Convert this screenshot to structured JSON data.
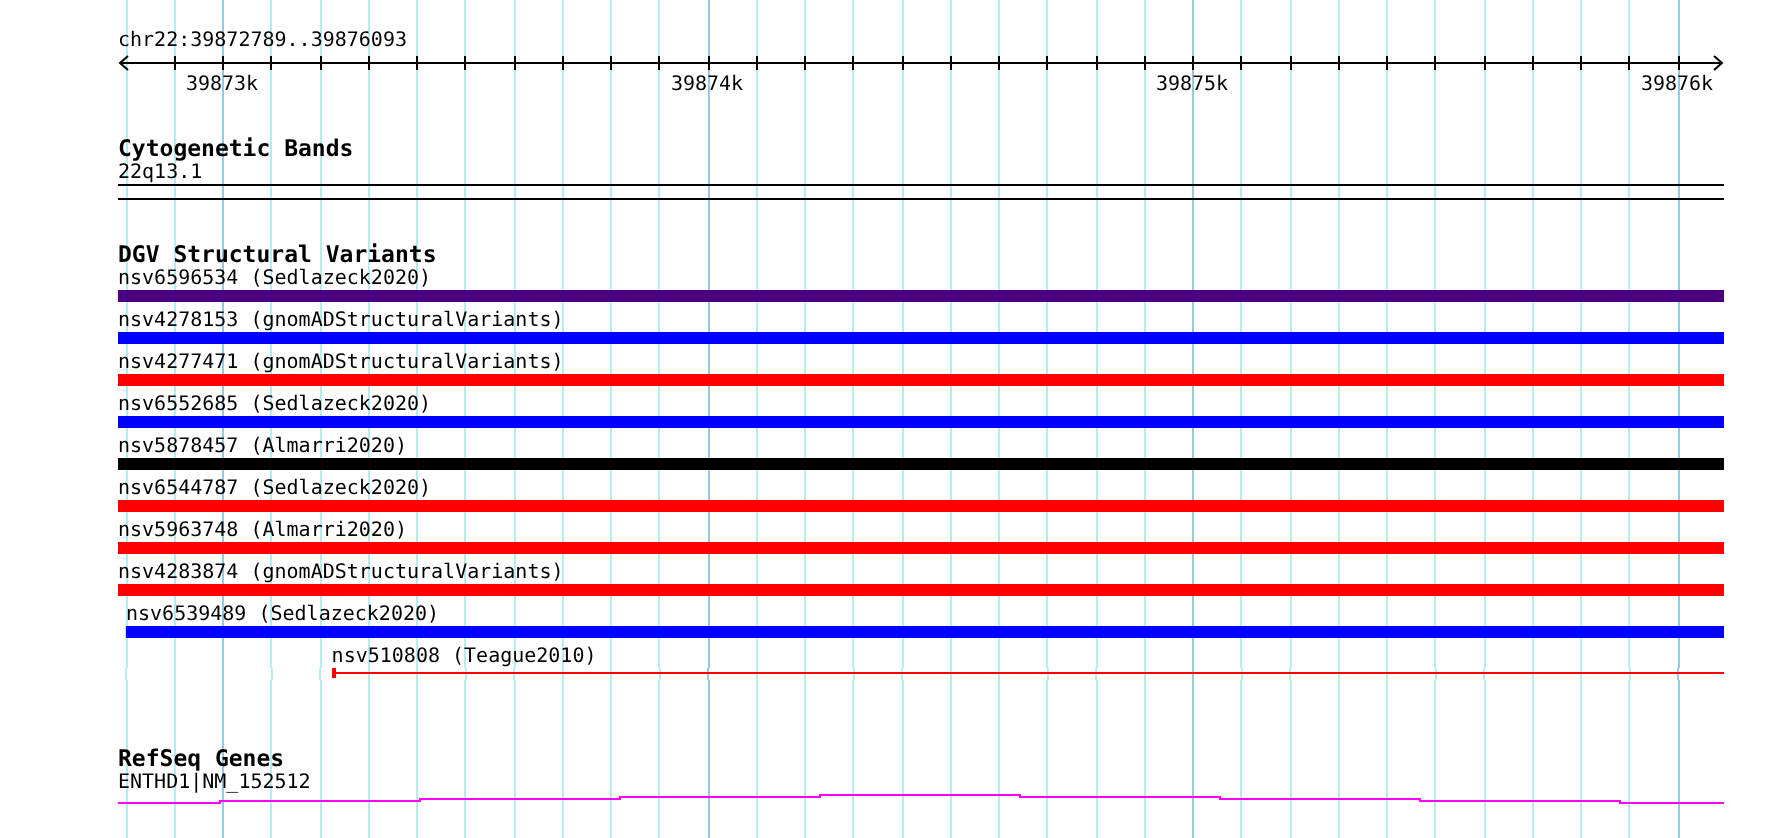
{
  "ruler": {
    "location": "chr22:39872789..39876093",
    "ticks": [
      "39873k",
      "39874k",
      "39875k",
      "39876k"
    ]
  },
  "tracks": [
    {
      "title": "Cytogenetic Bands",
      "kind": "cytoband",
      "features": [
        {
          "label": "22q13.1"
        }
      ]
    },
    {
      "title": "DGV Structural Variants",
      "kind": "variants",
      "features": [
        {
          "label": "nsv6596534 (Sedlazeck2020)",
          "kind": "bar",
          "color": "#4b0082"
        },
        {
          "label": "nsv4278153 (gnomADStructuralVariants)",
          "kind": "bar",
          "color": "#0000ff"
        },
        {
          "label": "nsv4277471 (gnomADStructuralVariants)",
          "kind": "bar",
          "color": "#ff0000"
        },
        {
          "label": "nsv6552685 (Sedlazeck2020)",
          "kind": "bar",
          "color": "#0000ff"
        },
        {
          "label": "nsv5878457 (Almarri2020)",
          "kind": "bar",
          "color": "#000000"
        },
        {
          "label": "nsv6544787 (Sedlazeck2020)",
          "kind": "bar",
          "color": "#ff0000"
        },
        {
          "label": "nsv5963748 (Almarri2020)",
          "kind": "bar",
          "color": "#ff0000"
        },
        {
          "label": "nsv4283874 (gnomADStructuralVariants)",
          "kind": "bar",
          "color": "#ff0000"
        },
        {
          "label": "nsv6539489 (Sedlazeck2020)",
          "kind": "bar",
          "color": "#0000ff",
          "level": 0.995
        },
        {
          "label": "nsv510808 (Teague2010)",
          "kind": "line",
          "color": "#ff0000",
          "level": 0.867
        }
      ]
    },
    {
      "title": "RefSeq Genes",
      "kind": "genes",
      "features": [
        {
          "label": "ENTHD1|NM_152512"
        }
      ]
    }
  ]
}
